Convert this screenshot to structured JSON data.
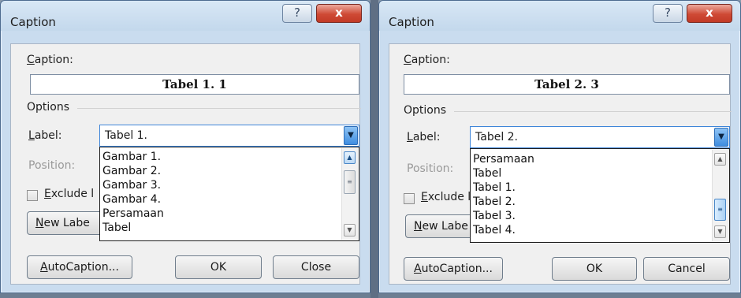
{
  "left_dialog": {
    "title": "Caption",
    "help_label": "?",
    "close_label": "x",
    "caption_label_u": "C",
    "caption_label_rest": "aption:",
    "caption_value": "Tabel 1. 1",
    "options_label": "Options",
    "label_label_u": "L",
    "label_label_rest": "abel:",
    "label_value": "Tabel 1.",
    "position_label": "Position:",
    "dropdown_items": [
      "Gambar 1.",
      "Gambar 2.",
      "Gambar 3.",
      "Gambar 4.",
      "Persamaan",
      "Tabel"
    ],
    "exclude_u": "E",
    "exclude_rest": "xclude l",
    "new_label_u": "N",
    "new_label_rest": "ew Labe",
    "autocaption_u": "A",
    "autocaption_rest": "utoCaption...",
    "ok_label": "OK",
    "close_button_label": "Close"
  },
  "right_dialog": {
    "title": "Caption",
    "help_label": "?",
    "close_label": "x",
    "caption_label_u": "C",
    "caption_label_rest": "aption:",
    "caption_value": "Tabel 2. 3",
    "options_label": "Options",
    "label_label_u": "L",
    "label_label_rest": "abel:",
    "label_value": "Tabel 2.",
    "position_label": "Position:",
    "dropdown_items": [
      "Persamaan",
      "Tabel",
      "Tabel 1.",
      "Tabel 2.",
      "Tabel 3.",
      "Tabel 4."
    ],
    "exclude_u": "E",
    "exclude_rest": "xclude l",
    "new_label_u": "N",
    "new_label_rest": "ew Labe",
    "autocaption_u": "A",
    "autocaption_rest": "utoCaption...",
    "ok_label": "OK",
    "cancel_label": "Cancel"
  }
}
